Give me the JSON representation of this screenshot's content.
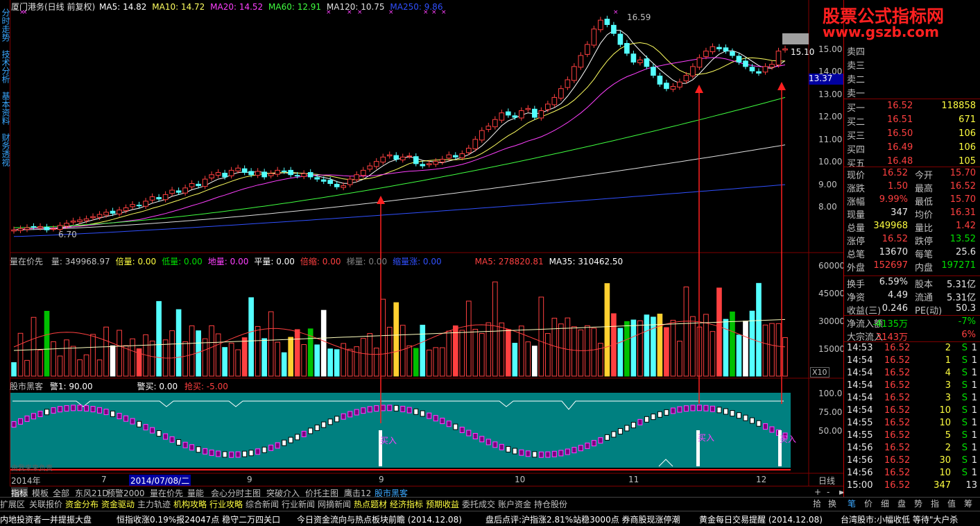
{
  "header": {
    "title": "厦门港务(日线 前复权)",
    "ma5": "MA5: 14.82",
    "ma10": "MA10: 14.72",
    "ma20": "MA20: 14.52",
    "ma60": "MA60: 12.91",
    "ma120": "MA120: 10.75",
    "ma250": "MA250: 9.86"
  },
  "sidebar": [
    "分时走势",
    "技术分析",
    "基本资料",
    "财务透视"
  ],
  "price_axis": [
    "15.00",
    "14.00",
    "13.00",
    "12.00",
    "11.00",
    "10.00",
    "9.00",
    "8.00"
  ],
  "price_marks": {
    "high": "16.59",
    "low": "6.70",
    "cur": "15.10",
    "cross": "13.37"
  },
  "volume_header": {
    "name": "量在价先",
    "items": [
      {
        "t": "量: 349968.97",
        "c": "#c0c0c0"
      },
      {
        "t": "倍量: 0.00",
        "c": "#ffff40"
      },
      {
        "t": "低量: 0.00",
        "c": "#00e000"
      },
      {
        "t": "地量: 0.00",
        "c": "#ff40ff"
      },
      {
        "t": "平量: 0.00",
        "c": "#ffffff"
      },
      {
        "t": "倍缩: 0.00",
        "c": "#ff4040"
      },
      {
        "t": "梯量: 0.00",
        "c": "#808080"
      },
      {
        "t": "缩量涨: 0.00",
        "c": "#3050ff"
      },
      {
        "t": "MA5: 278820.81",
        "c": "#ff4040"
      },
      {
        "t": "MA35: 310462.50",
        "c": "#ffffff"
      }
    ]
  },
  "volume_axis": [
    "60000",
    "45000",
    "30000",
    "15000"
  ],
  "volume_unit": "X10",
  "indicator_header": {
    "name": "股市黑客",
    "warn": "警1: 90.00",
    "alert": "警买: 0.00",
    "buy": "抢买: -5.00"
  },
  "indicator_axis": [
    "100.0",
    "75.00",
    "50.00"
  ],
  "indicator_labels": {
    "buy": "买入",
    "small": "由我来来负责"
  },
  "dates": {
    "year": "2014年",
    "m7": "7",
    "sel": "2014/07/08/二",
    "m9": "9",
    "m10": "10",
    "m11": "11",
    "m12": "12"
  },
  "tabs": [
    "指标",
    "模板",
    "全部",
    "东风21D",
    "预警2000",
    "量在价先",
    "量能",
    "会心分时主图",
    "突破介入",
    "价托主图",
    "鹰击12",
    "股市黑客"
  ],
  "period": "日线",
  "menu": [
    {
      "t": "扩展区",
      "y": false
    },
    {
      "t": "关联报价",
      "y": false
    },
    {
      "t": "资金分布",
      "y": true
    },
    {
      "t": "资金驱动",
      "y": true
    },
    {
      "t": "主力轨迹",
      "y": false
    },
    {
      "t": "机构攻略",
      "y": true
    },
    {
      "t": "行业攻略",
      "y": true
    },
    {
      "t": "综合新闻",
      "y": false
    },
    {
      "t": "行业新闻",
      "y": false
    },
    {
      "t": "网摘新闻",
      "y": false
    },
    {
      "t": "热点题材",
      "y": true
    },
    {
      "t": "经济指标",
      "y": true
    },
    {
      "t": "预期收益",
      "y": true
    },
    {
      "t": "委托成交",
      "y": false
    },
    {
      "t": "账户资金",
      "y": false
    },
    {
      "t": "持仓股份",
      "y": false
    }
  ],
  "right_tabs": [
    "笔",
    "价",
    "细",
    "盘",
    "势",
    "指",
    "值",
    "筹"
  ],
  "right_small": [
    "拾",
    "换"
  ],
  "ticker": [
    {
      "t": "内地投资者一并提振大盘",
      "c": "#ffffff"
    },
    {
      "t": "恒指收涨0.19%报24047点 稳守二万四关口",
      "c": "#ffffff"
    },
    {
      "t": "今日资金流向与热点板块前瞻 (2014.12.08)",
      "c": "#ffffff"
    },
    {
      "t": "盘后点评:沪指涨2.81%站稳3000点 券商股现涨停潮",
      "c": "#ffffff"
    },
    {
      "t": "黄金每日交易提醒 (2014.12.08)",
      "c": "#ffffff"
    },
    {
      "t": "台湾股市:小幅收低 等待\"大户杀",
      "c": "#ffffff"
    }
  ],
  "watermark": {
    "line1": "股票公式指标网",
    "line2": "www.gszb.com"
  },
  "orderbook": {
    "sell": [
      "卖四",
      "卖三",
      "卖二",
      "卖一"
    ],
    "buy": [
      {
        "l": "买一",
        "p": "16.52",
        "v": "118858"
      },
      {
        "l": "买二",
        "p": "16.51",
        "v": "671"
      },
      {
        "l": "买三",
        "p": "16.50",
        "v": "106"
      },
      {
        "l": "买四",
        "p": "16.49",
        "v": "106"
      },
      {
        "l": "买五",
        "p": "16.48",
        "v": "105"
      }
    ]
  },
  "quote": [
    {
      "l1": "现价",
      "v1": "16.52",
      "c1": "red",
      "l2": "今开",
      "v2": "15.70",
      "c2": "red"
    },
    {
      "l1": "涨跌",
      "v1": "1.50",
      "c1": "red",
      "l2": "最高",
      "v2": "16.52",
      "c2": "red"
    },
    {
      "l1": "涨幅",
      "v1": "9.99%",
      "c1": "red",
      "l2": "最低",
      "v2": "15.70",
      "c2": "red"
    },
    {
      "l1": "现量",
      "v1": "347",
      "c1": "white",
      "l2": "均价",
      "v2": "16.31",
      "c2": "red"
    },
    {
      "l1": "总量",
      "v1": "349968",
      "c1": "yellow",
      "l2": "量比",
      "v2": "1.42",
      "c2": "red"
    },
    {
      "l1": "涨停",
      "v1": "16.52",
      "c1": "red",
      "l2": "跌停",
      "v2": "13.52",
      "c2": "green"
    },
    {
      "l1": "总笔",
      "v1": "13670",
      "c1": "white",
      "l2": "每笔",
      "v2": "25.6",
      "c2": "white"
    },
    {
      "l1": "外盘",
      "v1": "152697",
      "c1": "red",
      "l2": "内盘",
      "v2": "197271",
      "c2": "green"
    },
    {
      "l1": "换手",
      "v1": "6.59%",
      "c1": "white",
      "l2": "股本",
      "v2": "5.31亿",
      "c2": "white"
    },
    {
      "l1": "净资",
      "v1": "4.49",
      "c1": "white",
      "l2": "流通",
      "v2": "5.31亿",
      "c2": "white"
    },
    {
      "l1": "收益(三)",
      "v1": "0.246",
      "c1": "white",
      "l2": "PE(动)",
      "v2": "50.3",
      "c2": "white"
    },
    {
      "l1": "净流入额",
      "v1": "-4135万",
      "c1": "green",
      "l2": "",
      "v2": "-7%",
      "c2": "green"
    },
    {
      "l1": "大宗流入",
      "v1": "3143万",
      "c1": "red",
      "l2": "",
      "v2": "6%",
      "c2": "red"
    }
  ],
  "ticks": [
    {
      "t": "14:53",
      "p": "16.52",
      "v": "2",
      "s": "S",
      "n": "1"
    },
    {
      "t": "14:54",
      "p": "16.52",
      "v": "1",
      "s": "S",
      "n": "1"
    },
    {
      "t": "14:54",
      "p": "16.52",
      "v": "4",
      "s": "S",
      "n": "1"
    },
    {
      "t": "14:54",
      "p": "16.52",
      "v": "3",
      "s": "S",
      "n": "1"
    },
    {
      "t": "14:54",
      "p": "16.52",
      "v": "3",
      "s": "S",
      "n": "1"
    },
    {
      "t": "14:54",
      "p": "16.52",
      "v": "10",
      "s": "S",
      "n": "1"
    },
    {
      "t": "14:55",
      "p": "16.52",
      "v": "10",
      "s": "S",
      "n": "1"
    },
    {
      "t": "14:55",
      "p": "16.52",
      "v": "5",
      "s": "S",
      "n": "1"
    },
    {
      "t": "14:56",
      "p": "16.52",
      "v": "2",
      "s": "S",
      "n": "1"
    },
    {
      "t": "14:56",
      "p": "16.52",
      "v": "30",
      "s": "S",
      "n": "1"
    },
    {
      "t": "14:56",
      "p": "16.52",
      "v": "10",
      "s": "S",
      "n": "1"
    },
    {
      "t": "15:00",
      "p": "16.52",
      "v": "347",
      "s": "",
      "n": "13"
    }
  ],
  "chart_data": {
    "type": "candlestick",
    "closes": [
      6.9,
      6.95,
      7.0,
      7.02,
      7.05,
      6.9,
      6.95,
      7.1,
      7.2,
      7.3,
      7.35,
      7.4,
      7.5,
      7.6,
      7.7,
      7.65,
      7.8,
      7.9,
      8.05,
      8.0,
      8.2,
      8.4,
      8.3,
      8.5,
      8.7,
      8.6,
      8.8,
      9.0,
      8.9,
      9.2,
      9.4,
      9.5,
      9.3,
      9.6,
      9.7,
      9.5,
      9.4,
      9.55,
      9.3,
      9.45,
      9.6,
      9.55,
      9.4,
      9.35,
      9.45,
      9.3,
      9.2,
      9.1,
      9.0,
      8.85,
      8.9,
      9.2,
      9.4,
      9.6,
      9.8,
      10.0,
      10.2,
      10.3,
      10.1,
      10.2,
      10.25,
      9.9,
      9.8,
      9.9,
      10.0,
      10.1,
      10.3,
      10.2,
      10.35,
      10.6,
      11.0,
      11.4,
      11.6,
      11.9,
      12.2,
      12.1,
      12.0,
      12.3,
      12.4,
      12.0,
      12.3,
      12.6,
      12.9,
      13.3,
      13.7,
      14.3,
      14.8,
      15.3,
      16.0,
      16.4,
      16.2,
      15.8,
      15.3,
      14.9,
      14.5,
      14.6,
      14.3,
      13.9,
      13.5,
      13.3,
      13.4,
      13.6,
      13.9,
      14.3,
      14.7,
      15.0,
      15.2,
      15.1,
      15.0,
      14.8,
      14.5,
      14.3,
      14.1,
      14.0,
      14.3,
      14.4,
      15.0,
      15.1
    ],
    "ylim": [
      6.5,
      17
    ]
  }
}
